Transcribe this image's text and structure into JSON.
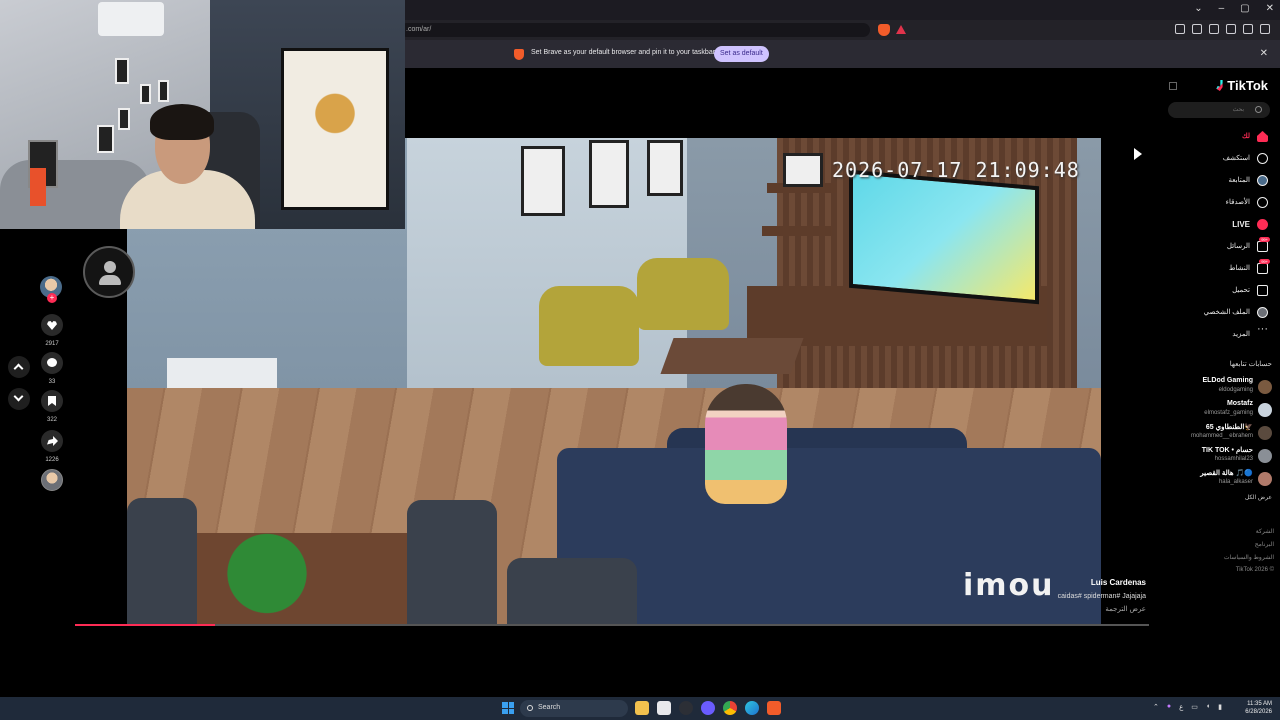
{
  "browser": {
    "url": ".com/ar/",
    "window_controls": [
      "⌄",
      "–",
      "▢",
      "✕"
    ],
    "infobar": {
      "message": "Set Brave as your default browser and pin it to your taskbar",
      "button_label": "Set as default",
      "close_label": "✕"
    }
  },
  "video": {
    "timestamp": "2026-07-17 21:09:48",
    "logo": "imou",
    "progress_fraction": 0.13
  },
  "caption": {
    "author": "Luis Cardenas",
    "tags": "caidas# spiderman# Jajajaja",
    "translate_label": "عرض الترجمة"
  },
  "actions": {
    "likes": "2917",
    "comments": "33",
    "saves": "322",
    "shares": "1226",
    "follow_plus": "+"
  },
  "sidebar": {
    "logo": "TikTok",
    "search_placeholder": "بحث",
    "nav": [
      {
        "label": "لك",
        "icon": "home-icon",
        "active": true
      },
      {
        "label": "استكشف",
        "icon": "compass-icon"
      },
      {
        "label": "المتابعة",
        "icon": "following-avatar-icon"
      },
      {
        "label": "الأصدقاء",
        "icon": "friends-icon"
      },
      {
        "label": "LIVE",
        "icon": "live-icon"
      },
      {
        "label": "الرسائل",
        "icon": "messages-icon",
        "badge": "99+"
      },
      {
        "label": "النشاط",
        "icon": "activity-icon",
        "badge": "99+"
      },
      {
        "label": "تحميل",
        "icon": "upload-icon"
      },
      {
        "label": "الملف الشخصي",
        "icon": "profile-icon"
      },
      {
        "label": "المزيد",
        "icon": "more-icon"
      }
    ],
    "following_title": "حسابات تتابعها",
    "following": [
      {
        "name": "ELDod Gaming",
        "username": "eldodgaming"
      },
      {
        "name": "Mostafz",
        "username": "elmostafz_gaming"
      },
      {
        "name": "الطنطاوي 65🦅",
        "username": "mohammed__ebrahem"
      },
      {
        "name": "TIK TOK • حسام",
        "username": "hossamhilal23"
      },
      {
        "name": "هالة القصير 🎵🔵",
        "username": "hala_alkaser"
      }
    ],
    "see_more": "عرض الكل",
    "footer": [
      "الشركة",
      "البرنامج",
      "الشروط والسياسات",
      "TikTok 2026 ©"
    ]
  },
  "taskbar": {
    "search_placeholder": "Search",
    "time": "11:35 AM",
    "date": "6/28/2026",
    "lang": "ع"
  },
  "colors": {
    "accent": "#fe2c55",
    "brave": "#f25c2a",
    "infobar_button": "#cfc3ff"
  }
}
